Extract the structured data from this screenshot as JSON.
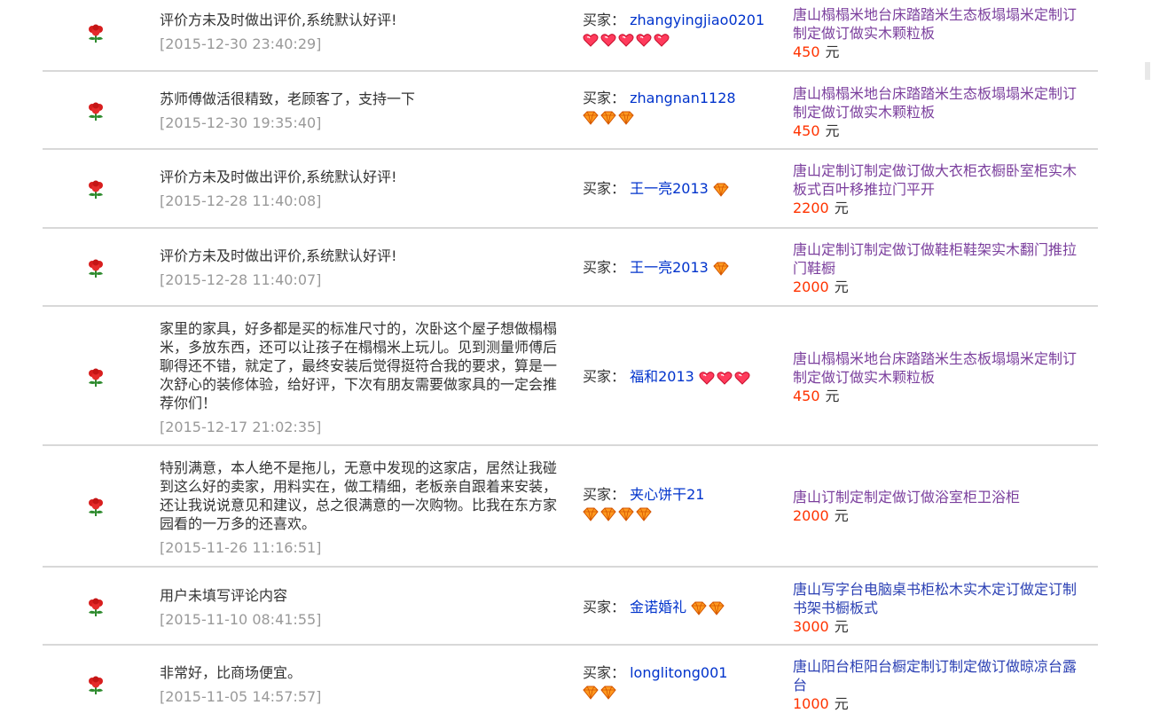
{
  "labels": {
    "buyer_prefix": "买家：",
    "currency": "元"
  },
  "reviews": [
    {
      "comment": "评价方未及时做出评价,系统默认好评!",
      "date": "[2015-12-30 23:40:29]",
      "buyer": "zhangyingjiao0201",
      "badge_type": "heart",
      "badge_count": 5,
      "product": "唐山榻榻米地台床踏踏米生态板塌塌米定制订制定做订做实木颗粒板",
      "price": "450"
    },
    {
      "comment": "苏师傅做活很精致，老顾客了，支持一下",
      "date": "[2015-12-30 19:35:40]",
      "buyer": "zhangnan1128",
      "badge_type": "diamond",
      "badge_count": 3,
      "product": "唐山榻榻米地台床踏踏米生态板塌塌米定制订制定做订做实木颗粒板",
      "price": "450"
    },
    {
      "comment": "评价方未及时做出评价,系统默认好评!",
      "date": "[2015-12-28 11:40:08]",
      "buyer": "王一亮2013",
      "badge_type": "diamond",
      "badge_count": 1,
      "product": "唐山定制订制定做订做大衣柜衣橱卧室柜实木板式百叶移推拉门平开",
      "price": "2200"
    },
    {
      "comment": "评价方未及时做出评价,系统默认好评!",
      "date": "[2015-12-28 11:40:07]",
      "buyer": "王一亮2013",
      "badge_type": "diamond",
      "badge_count": 1,
      "product": "唐山定制订制定做订做鞋柜鞋架实木翻门推拉门鞋橱",
      "price": "2000"
    },
    {
      "comment": "家里的家具，好多都是买的标准尺寸的，次卧这个屋子想做榻榻米，多放东西，还可以让孩子在榻榻米上玩儿。见到测量师傅后聊得还不错，就定了，最终安装后觉得挺符合我的要求，算是一次舒心的装修体验，给好评，下次有朋友需要做家具的一定会推荐你们！",
      "date": "[2015-12-17 21:02:35]",
      "buyer": "福和2013",
      "badge_type": "heart",
      "badge_count": 3,
      "product": "唐山榻榻米地台床踏踏米生态板塌塌米定制订制定做订做实木颗粒板",
      "price": "450"
    },
    {
      "comment": "特别满意，本人绝不是拖儿，无意中发现的这家店，居然让我碰到这么好的卖家，用料实在，做工精细，老板亲自跟着来安装，还让我说说意见和建议，总之很满意的一次购物。比我在东方家园看的一万多的还喜欢。",
      "date": "[2015-11-26 11:16:51]",
      "buyer": "夹心饼干21",
      "badge_type": "diamond",
      "badge_count": 4,
      "product": "唐山订制定制定做订做浴室柜卫浴柜",
      "price": "2000"
    },
    {
      "comment": "用户未填写评论内容",
      "date": "[2015-11-10 08:41:55]",
      "buyer": "金诺婚礼",
      "badge_type": "diamond",
      "badge_count": 2,
      "product": "唐山写字台电脑桌书柜松木实木定订做定订制书架书橱板式",
      "price": "3000"
    },
    {
      "comment": "非常好，比商场便宜。",
      "date": "[2015-11-05 14:57:57]",
      "buyer": "longlitong001",
      "badge_type": "diamond",
      "badge_count": 2,
      "product": "唐山阳台柜阳台橱定制订制定做订做晾凉台露台",
      "price": "1000"
    }
  ]
}
